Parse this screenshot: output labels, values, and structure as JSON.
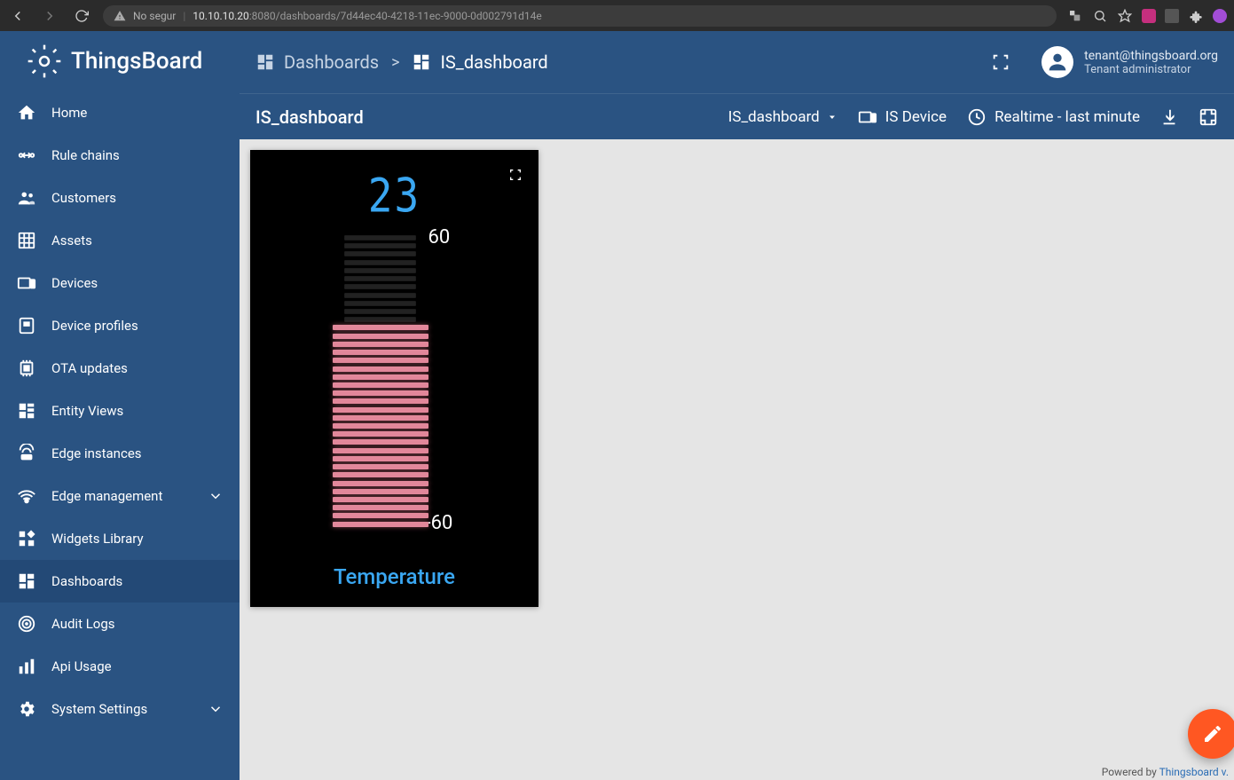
{
  "browser": {
    "insecure_label": "No segur",
    "url_host": "10.10.10.20",
    "url_port_path": ":8080/dashboards/7d44ec40-4218-11ec-9000-0d002791d14e"
  },
  "brand": "ThingsBoard",
  "sidebar": {
    "items": [
      {
        "label": "Home"
      },
      {
        "label": "Rule chains"
      },
      {
        "label": "Customers"
      },
      {
        "label": "Assets"
      },
      {
        "label": "Devices"
      },
      {
        "label": "Device profiles"
      },
      {
        "label": "OTA updates"
      },
      {
        "label": "Entity Views"
      },
      {
        "label": "Edge instances"
      },
      {
        "label": "Edge management"
      },
      {
        "label": "Widgets Library"
      },
      {
        "label": "Dashboards"
      },
      {
        "label": "Audit Logs"
      },
      {
        "label": "Api Usage"
      },
      {
        "label": "System Settings"
      }
    ]
  },
  "breadcrumb": {
    "root": "Dashboards",
    "current": "IS_dashboard"
  },
  "user": {
    "email": "tenant@thingsboard.org",
    "role": "Tenant administrator"
  },
  "subheader": {
    "title": "IS_dashboard",
    "state_label": "IS_dashboard",
    "entity_label": "IS Device",
    "time_label": "Realtime - last minute"
  },
  "widget": {
    "value": "23",
    "scale_max": "60",
    "scale_min": "-60",
    "title": "Temperature"
  },
  "footer": {
    "prefix": "Powered by ",
    "link": "Thingsboard v."
  }
}
